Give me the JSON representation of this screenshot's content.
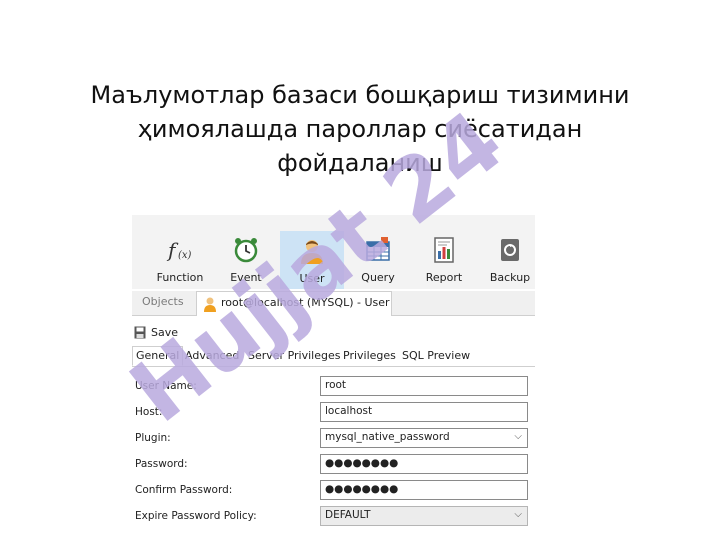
{
  "slide": {
    "title_lines": [
      "Маълумотлар базаси бошқариш тизимини",
      "ҳимоялашда пароллар сиёсатидан",
      "фойдаланиш"
    ]
  },
  "toolbar": {
    "items": [
      {
        "label": "Function",
        "icon": "function-icon"
      },
      {
        "label": "Event",
        "icon": "alarm-clock-icon"
      },
      {
        "label": "User",
        "icon": "user-icon",
        "active": true
      },
      {
        "label": "Query",
        "icon": "table-icon"
      },
      {
        "label": "Report",
        "icon": "report-icon"
      },
      {
        "label": "Backup",
        "icon": "backup-icon"
      }
    ]
  },
  "tabs": {
    "objects": "Objects",
    "document": "root@localhost (MYSQL) - User"
  },
  "actions": {
    "save": "Save"
  },
  "subtabs": [
    "General",
    "Advanced",
    "Server Privileges",
    "Privileges",
    "SQL Preview"
  ],
  "form": {
    "user_name": {
      "label": "User Name:",
      "value": "root"
    },
    "host": {
      "label": "Host:",
      "value": "localhost"
    },
    "plugin": {
      "label": "Plugin:",
      "value": "mysql_native_password"
    },
    "password": {
      "label": "Password:",
      "value": "●●●●●●●●"
    },
    "confirm_password": {
      "label": "Confirm Password:",
      "value": "●●●●●●●●"
    },
    "expire_policy": {
      "label": "Expire Password Policy:",
      "value": "DEFAULT"
    }
  },
  "watermark": {
    "text": "Hujjat 24",
    "color": "#b9a9de"
  },
  "colors": {
    "active_tool": "#cde3f5",
    "toolbar_bg": "#f3f3f3"
  }
}
